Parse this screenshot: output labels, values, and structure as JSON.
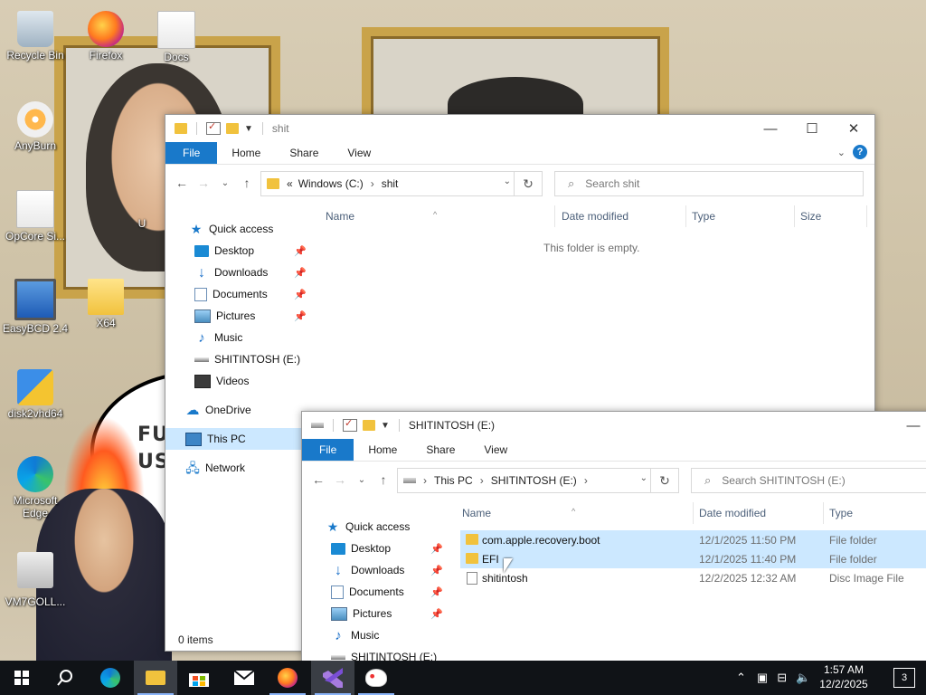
{
  "desktop": {
    "bubble_text_lines": [
      "FU",
      "US"
    ],
    "icons": [
      {
        "label": "Recycle Bin"
      },
      {
        "label": "Firefox"
      },
      {
        "label": "Docs"
      },
      {
        "label": "AnyBurn"
      },
      {
        "label": "OpCore Si..."
      },
      {
        "label": "EasyBCD 2.4"
      },
      {
        "label": "X64"
      },
      {
        "label": "disk2vhd64"
      },
      {
        "label": "Microsoft Edge"
      },
      {
        "label": "VM7GOLL..."
      },
      {
        "label": "U"
      }
    ]
  },
  "window1": {
    "title": "shit",
    "ribbon_tabs": [
      "File",
      "Home",
      "Share",
      "View"
    ],
    "address": {
      "prefix": "«",
      "crumbs": [
        "Windows (C:)",
        "shit"
      ]
    },
    "search_placeholder": "Search shit",
    "columns": [
      "Name",
      "Date modified",
      "Type",
      "Size"
    ],
    "empty_message": "This folder is empty.",
    "status": "0 items",
    "nav": [
      {
        "label": "Quick access",
        "icon": "star-icon"
      },
      {
        "label": "Desktop",
        "icon": "desktop-icon",
        "pinned": true
      },
      {
        "label": "Downloads",
        "icon": "downloads-icon",
        "pinned": true
      },
      {
        "label": "Documents",
        "icon": "documents-icon",
        "pinned": true
      },
      {
        "label": "Pictures",
        "icon": "pictures-icon",
        "pinned": true
      },
      {
        "label": "Music",
        "icon": "music-icon"
      },
      {
        "label": "SHITINTOSH (E:)",
        "icon": "drive-icon"
      },
      {
        "label": "Videos",
        "icon": "videos-icon"
      },
      {
        "label": "OneDrive",
        "icon": "onedrive-icon"
      },
      {
        "label": "This PC",
        "icon": "this-pc-icon",
        "selected": true
      },
      {
        "label": "Network",
        "icon": "network-icon"
      }
    ],
    "controls": {
      "minimize": "—",
      "maximize": "☐",
      "close": "✕"
    },
    "help": "?"
  },
  "window2": {
    "title": "SHITINTOSH (E:)",
    "ribbon_tabs": [
      "File",
      "Home",
      "Share",
      "View"
    ],
    "address": {
      "crumbs": [
        "This PC",
        "SHITINTOSH (E:)"
      ]
    },
    "search_placeholder": "Search SHITINTOSH (E:)",
    "columns": [
      "Name",
      "Date modified",
      "Type"
    ],
    "nav": [
      {
        "label": "Quick access",
        "icon": "star-icon"
      },
      {
        "label": "Desktop",
        "icon": "desktop-icon",
        "pinned": true
      },
      {
        "label": "Downloads",
        "icon": "downloads-icon",
        "pinned": true
      },
      {
        "label": "Documents",
        "icon": "documents-icon",
        "pinned": true
      },
      {
        "label": "Pictures",
        "icon": "pictures-icon",
        "pinned": true
      },
      {
        "label": "Music",
        "icon": "music-icon"
      },
      {
        "label": "SHITINTOSH (E:)",
        "icon": "drive-icon"
      }
    ],
    "files": [
      {
        "name": "com.apple.recovery.boot",
        "date": "12/1/2025 11:50 PM",
        "type": "File folder",
        "kind": "folder",
        "selected": true
      },
      {
        "name": "EFI",
        "date": "12/1/2025 11:40 PM",
        "type": "File folder",
        "kind": "folder",
        "selected": true
      },
      {
        "name": "shitintosh",
        "date": "12/2/2025 12:32 AM",
        "type": "Disc Image File",
        "kind": "file",
        "selected": false
      }
    ],
    "controls": {
      "minimize": "—"
    }
  },
  "taskbar": {
    "items": [
      "start-icon",
      "search-icon",
      "edge-icon",
      "file-explorer-icon",
      "store-icon",
      "mail-icon",
      "firefox-icon",
      "visual-studio-icon",
      "paint-icon"
    ],
    "clock_time": "1:57 AM",
    "clock_date": "12/2/2025",
    "notifications": "3"
  },
  "colors": {
    "accent": "#1979ca",
    "selection": "#cce8ff",
    "taskbar": "#101317"
  }
}
